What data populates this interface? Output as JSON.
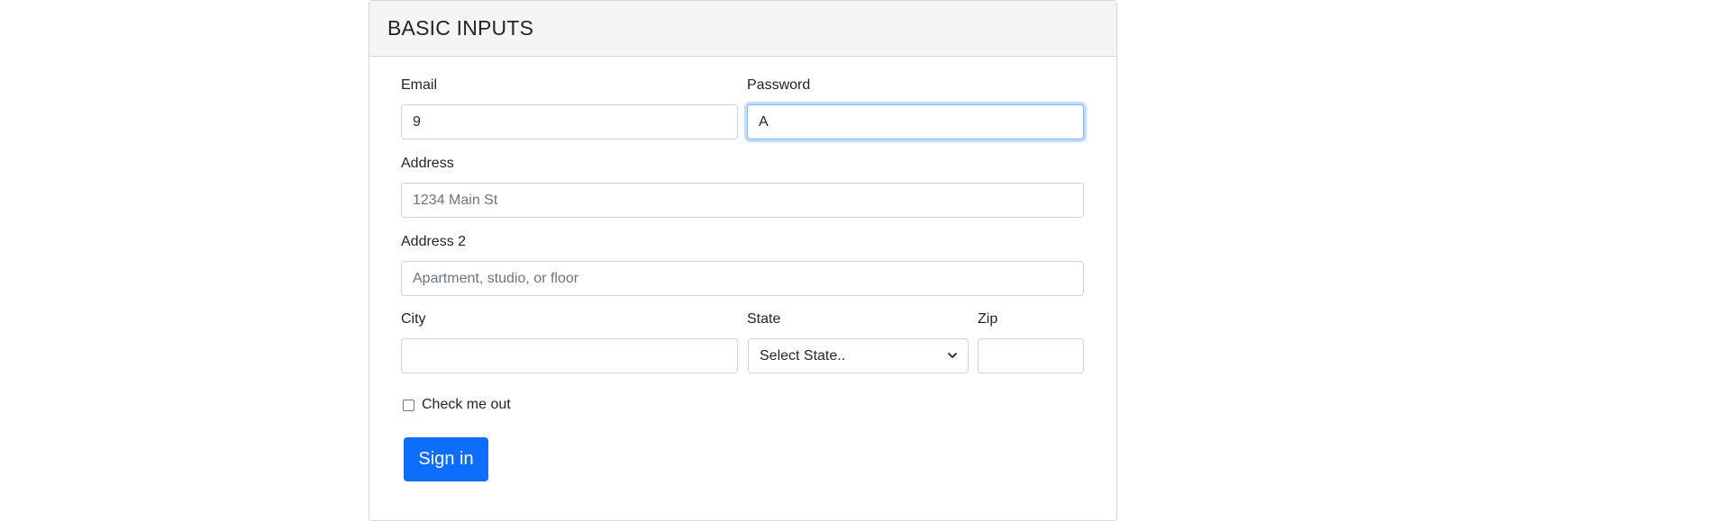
{
  "card": {
    "title": "BASIC INPUTS"
  },
  "form": {
    "email": {
      "label": "Email",
      "value": "9"
    },
    "password": {
      "label": "Password",
      "value": "A"
    },
    "address": {
      "label": "Address",
      "placeholder": "1234 Main St"
    },
    "address2": {
      "label": "Address 2",
      "placeholder": "Apartment, studio, or floor"
    },
    "city": {
      "label": "City",
      "value": ""
    },
    "state": {
      "label": "State",
      "selected": "Select State.."
    },
    "zip": {
      "label": "Zip",
      "value": ""
    },
    "check": {
      "label": "Check me out"
    },
    "submit_label": "Sign in"
  },
  "icons": {
    "state_dropdown": "chevron-down-icon"
  },
  "colors": {
    "primary": "#0d6efd",
    "header_bg": "#f5f5f5",
    "border": "#ced4da"
  }
}
